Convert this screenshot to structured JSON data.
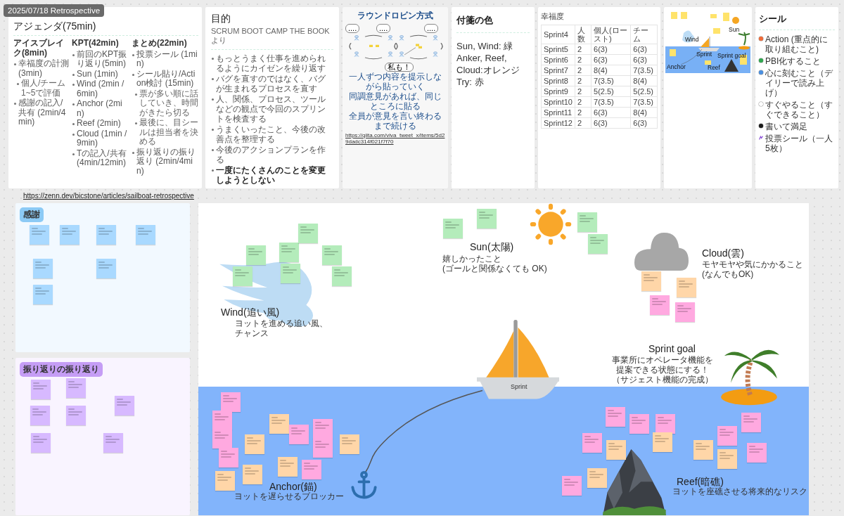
{
  "frame_label": "2025/07/18 Retrospective",
  "top_cards": [
    {
      "kind": "agenda",
      "title": "アジェンダ(75min)",
      "sections": [
        {
          "heading": "アイスブレイク(8min)",
          "items": [
            {
              "text": "幸福度の計測 (3min)",
              "children": [
                {
                  "text": "個人/チーム 1~5で評価"
                }
              ]
            },
            {
              "text": "感謝の記入/共有 (2min/4min)"
            }
          ]
        },
        {
          "heading": "KPT(42min)",
          "items": [
            {
              "text": "前回のKPT振り返り(5min)"
            },
            {
              "text": "Sun (1min)"
            },
            {
              "text": "Wind (2min / 6min)"
            },
            {
              "text": "Anchor (2min)"
            },
            {
              "text": "Reef (2min)"
            },
            {
              "text": "Cloud (1min / 9min)"
            },
            {
              "text": "Tの記入/共有(4min/12min)"
            }
          ]
        },
        {
          "heading": "まとめ(22min)",
          "items": [
            {
              "text": "投票シール (1min)"
            },
            {
              "text": "シール貼り/Action検討 (15min)",
              "children": [
                {
                  "text": "票が多い順に話していき、時間がきたら切る"
                },
                {
                  "text": "最後に、目シールは担当者を決める"
                }
              ]
            },
            {
              "text": "振り返りの振り返り (2min/4min)"
            }
          ]
        }
      ]
    },
    {
      "kind": "purpose",
      "title": "目的",
      "subtitle": "SCRUM BOOT CAMP THE BOOKより",
      "items": [
        {
          "text": "もっとうまく仕事を進められるようにカイゼンを繰り返す",
          "bold": false
        },
        {
          "text": "バグを直すのではなく、バグが生まれるプロセスを直す",
          "bold": false
        },
        {
          "text": "人、関係、プロセス、ツールなどの観点で今回のスプリントを検査する",
          "bold": false
        },
        {
          "text": "うまくいったこと、今後の改善点を整理する",
          "bold": false
        },
        {
          "text": "今後のアクションプランを作る",
          "bold": false
        },
        {
          "text": "一度にたくさんのことを変更しようとしない",
          "bold": true
        }
      ]
    },
    {
      "kind": "robin",
      "title": "ラウンドロビン方式",
      "bubbles": [
        "....",
        "....",
        "....",
        "私も！"
      ],
      "caption": [
        "一人ずつ内容を提示しながら貼っていく",
        "同調意見があれば、同じところに貼る",
        "全員が意見を言い終わるまで続ける"
      ],
      "source": "https://qiita.com/viva_tweet_x/items/5d29dadc314f021f7f70"
    },
    {
      "kind": "colors",
      "title": "付箋の色",
      "lines": [
        "Sun, Wind: 緑",
        "Anker, Reef, Cloud:オレンジ",
        "Try: 赤"
      ]
    },
    {
      "kind": "happiness",
      "title": "幸福度",
      "columns": [
        "Sprint4",
        "人数",
        "個人(ロースト)",
        "チーム"
      ],
      "rows": [
        [
          "Sprint5",
          "2",
          "6(3)",
          "6(3)"
        ],
        [
          "Sprint6",
          "2",
          "6(3)",
          "6(3)"
        ],
        [
          "Sprint7",
          "2",
          "8(4)",
          "7(3.5)"
        ],
        [
          "Sprint8",
          "2",
          "7(3.5)",
          "8(4)"
        ],
        [
          "Sprint9",
          "2",
          "5(2.5)",
          "5(2.5)"
        ],
        [
          "Sprint10",
          "2",
          "7(3.5)",
          "7(3.5)"
        ],
        [
          "Sprint11",
          "2",
          "6(3)",
          "8(4)"
        ],
        [
          "Sprint12",
          "2",
          "6(3)",
          "6(3)"
        ]
      ]
    },
    {
      "kind": "thumbnail",
      "labels": [
        {
          "kind": "wind",
          "text": "Wind"
        },
        {
          "kind": "sun",
          "text": "Sun"
        },
        {
          "kind": "sprint",
          "text": "Sprint"
        },
        {
          "kind": "goal",
          "text": "Sprint goal"
        },
        {
          "kind": "anchor",
          "text": "Anchor"
        },
        {
          "kind": "reef",
          "text": "Reef"
        }
      ]
    },
    {
      "kind": "stickers",
      "title": "シール",
      "items": [
        {
          "label": "Action (重点的に取り組むこと)",
          "color": "#f26b38"
        },
        {
          "label": "PBI化すること",
          "color": "#2fa84f"
        },
        {
          "label": "心に刻むこと（デイリーで読み上げ）",
          "color": "#4a90e2"
        },
        {
          "label": "すぐやること（すぐできること）",
          "color": "#ffffff"
        },
        {
          "label": "書いて満足",
          "color": "#1a1a1a"
        }
      ],
      "vote": "投票シール（一人5枚）"
    }
  ],
  "link": "https://zenn.dev/bicstone/articles/sailboat-retrospective",
  "panels": [
    {
      "kind": "thanks",
      "title": "感謝",
      "notes": [
        {
          "color": "#a9d9ff"
        },
        {
          "color": "#a9d9ff"
        },
        {
          "color": "#a9d9ff"
        },
        {
          "color": "#a9d9ff"
        },
        {
          "color": "#a9d9ff"
        },
        {
          "color": "#a9d9ff"
        },
        {
          "color": "#a9d9ff"
        }
      ]
    },
    {
      "kind": "retro",
      "title": "振り返りの振り返り",
      "notes": [
        {
          "color": "#d7b9ff"
        },
        {
          "color": "#d7b9ff"
        },
        {
          "color": "#d7b9ff"
        },
        {
          "color": "#d7b9ff"
        },
        {
          "color": "#d7b9ff"
        },
        {
          "color": "#d7b9ff"
        },
        {
          "color": "#d7b9ff"
        }
      ]
    }
  ],
  "board": {
    "boat_label": "Sprint",
    "areas": [
      {
        "kind": "wind",
        "title": "Wind(追い風)",
        "lines": [
          "ヨットを進める追い風、",
          "チャンス"
        ],
        "notes": [
          {
            "color": "#b4ecbb"
          },
          {
            "color": "#b4ecbb"
          },
          {
            "color": "#b4ecbb"
          },
          {
            "color": "#b4ecbb"
          },
          {
            "color": "#b4ecbb"
          },
          {
            "color": "#b4ecbb"
          },
          {
            "color": "#b4ecbb"
          }
        ]
      },
      {
        "kind": "sun",
        "title": "Sun(太陽)",
        "lines": [
          "嬉しかったこと",
          "(ゴールと関係なくても OK)"
        ],
        "notes": [
          {
            "color": "#b4ecbb"
          },
          {
            "color": "#b4ecbb"
          },
          {
            "color": "#b4ecbb"
          },
          {
            "color": "#b4ecbb"
          }
        ]
      },
      {
        "kind": "cloud",
        "title": "Cloud(雲)",
        "lines": [
          "モヤモヤや気にかかること",
          "(なんでもOK)"
        ],
        "notes": [
          {
            "color": "#ffd6a8"
          },
          {
            "color": "#ffd6a8"
          },
          {
            "color": "#ffa9e0"
          },
          {
            "color": "#ffa9e0"
          }
        ]
      },
      {
        "kind": "goal",
        "title": "Sprint goal",
        "lines": [
          "事業所にオペレータ機能を",
          "提案できる状態にする！",
          "（サジェスト機能の完成）"
        ]
      },
      {
        "kind": "anchor",
        "title": "Anchor(錨)",
        "lines": [
          "ヨットを遅らせるブロッカー"
        ],
        "notes": [
          {
            "color": "#ffa9e0"
          },
          {
            "color": "#ffa9e0"
          },
          {
            "color": "#ffa9e0"
          },
          {
            "color": "#ffa9e0"
          },
          {
            "color": "#ffd6a8"
          },
          {
            "color": "#ffd6a8"
          },
          {
            "color": "#ffd6a8"
          },
          {
            "color": "#ffd6a8"
          },
          {
            "color": "#ffa9e0"
          },
          {
            "color": "#ffa9e0"
          },
          {
            "color": "#ffa9e0"
          },
          {
            "color": "#ffd6a8"
          },
          {
            "color": "#ffd6a8"
          },
          {
            "color": "#ffa9e0"
          }
        ]
      },
      {
        "kind": "reef",
        "title": "Reef(暗礁)",
        "lines": [
          "ヨットを座礁させる将来的なリスク"
        ],
        "notes": [
          {
            "color": "#ffa9e0"
          },
          {
            "color": "#ffa9e0"
          },
          {
            "color": "#ffa9e0"
          },
          {
            "color": "#ffa9e0"
          },
          {
            "color": "#ffd6a8"
          },
          {
            "color": "#ffd6a8"
          },
          {
            "color": "#ffd6a8"
          },
          {
            "color": "#ffa9e0"
          },
          {
            "color": "#ffd6a8"
          },
          {
            "color": "#ffa9e0"
          },
          {
            "color": "#ffa9e0"
          },
          {
            "color": "#ffa9e0"
          },
          {
            "color": "#ffd6a8"
          }
        ]
      }
    ]
  }
}
